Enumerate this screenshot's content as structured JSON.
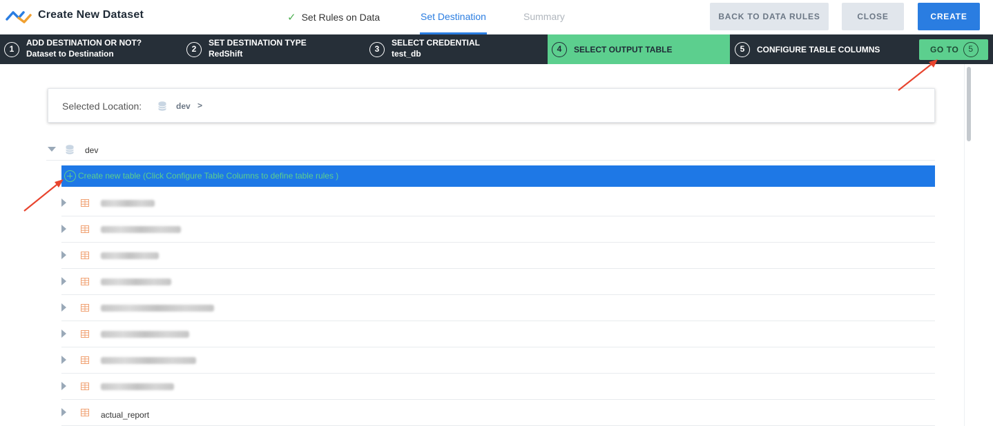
{
  "header": {
    "title": "Create New Dataset",
    "tabs": [
      {
        "label": "Set Rules on Data",
        "state": "done"
      },
      {
        "label": "Set Destination",
        "state": "active"
      },
      {
        "label": "Summary",
        "state": "disabled"
      }
    ],
    "buttons": {
      "back": "BACK TO DATA RULES",
      "close": "CLOSE",
      "create": "CREATE"
    }
  },
  "steps": [
    {
      "num": "1",
      "title": "ADD DESTINATION OR NOT?",
      "value": "Dataset to Destination"
    },
    {
      "num": "2",
      "title": "SET DESTINATION TYPE",
      "value": "RedShift"
    },
    {
      "num": "3",
      "title": "SELECT CREDENTIAL",
      "value": "test_db"
    },
    {
      "num": "4",
      "title": "SELECT OUTPUT TABLE",
      "value": ""
    },
    {
      "num": "5",
      "title": "CONFIGURE TABLE COLUMNS",
      "value": ""
    }
  ],
  "goto": {
    "label": "GO TO",
    "num": "5"
  },
  "location": {
    "label": "Selected Location:",
    "value": "dev",
    "separator": ">"
  },
  "tree": {
    "root_label": "dev",
    "create_new_label": "Create new table (Click Configure Table Columns to define table rules )",
    "rows": [
      {
        "name": "",
        "blurred": true
      },
      {
        "name": "",
        "blurred": true
      },
      {
        "name": "",
        "blurred": true
      },
      {
        "name": "",
        "blurred": true
      },
      {
        "name": "",
        "blurred": true
      },
      {
        "name": "",
        "blurred": true
      },
      {
        "name": "",
        "blurred": true
      },
      {
        "name": "",
        "blurred": true
      },
      {
        "name": "actual_report",
        "blurred": false
      }
    ]
  },
  "colors": {
    "accent_blue": "#2a7de1",
    "accent_green": "#5ccf8e",
    "step_bar": "#262f38",
    "table_icon": "#f0a070",
    "arrow_red": "#e8442e"
  }
}
